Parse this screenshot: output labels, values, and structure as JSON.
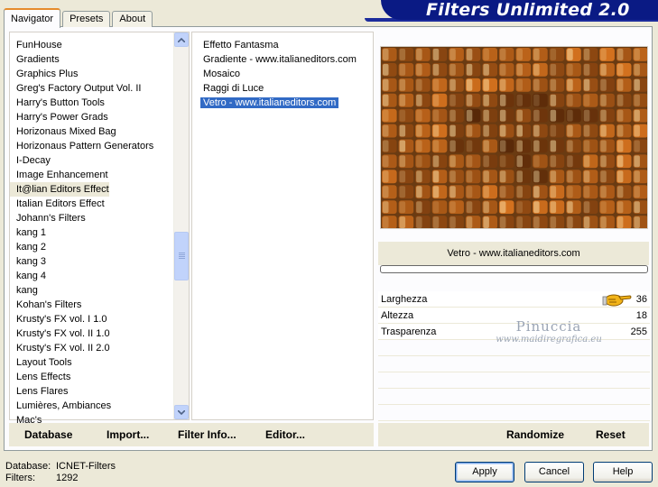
{
  "app": {
    "title": "Filters Unlimited 2.0"
  },
  "tabs": [
    {
      "label": "Navigator",
      "active": true
    },
    {
      "label": "Presets",
      "active": false
    },
    {
      "label": "About",
      "active": false
    }
  ],
  "categories": {
    "items": [
      "FunHouse",
      "Gradients",
      "Graphics Plus",
      "Greg's Factory Output Vol. II",
      "Harry's Button Tools",
      "Harry's Power Grads",
      "Horizonaus Mixed Bag",
      "Horizonaus Pattern Generators",
      "I-Decay",
      "Image Enhancement",
      "It@lian Editors Effect",
      "Italian Editors Effect",
      "Johann's Filters",
      "kang 1",
      "kang 2",
      "kang 3",
      "kang 4",
      "kang",
      "Kohan's Filters",
      "Krusty's FX vol. I 1.0",
      "Krusty's FX vol. II 1.0",
      "Krusty's FX vol. II 2.0",
      "Layout Tools",
      "Lens Effects",
      "Lens Flares",
      "Lumières, Ambiances",
      "Mac's"
    ],
    "selected_index": 10
  },
  "filters": {
    "items": [
      "Effetto Fantasma",
      "Gradiente - www.italianeditors.com",
      "Mosaico",
      "Raggi di Luce",
      "Vetro - www.italianeditors.com"
    ],
    "selected_index": 4
  },
  "filter_panel": {
    "current_filter": "Vetro - www.italianeditors.com",
    "progress": 0,
    "parameters": [
      {
        "name": "Larghezza",
        "value": "36"
      },
      {
        "name": "Altezza",
        "value": "18"
      },
      {
        "name": "Trasparenza",
        "value": "255"
      }
    ],
    "watermark": {
      "line1": "Pinuccia",
      "line2": "www.maidiregrafica.eu"
    }
  },
  "left_bar": {
    "database": {
      "label": "Database",
      "underline": "D"
    },
    "import": {
      "label": "Import...",
      "underline": "I"
    },
    "filter_info": {
      "label": "Filter Info...",
      "underline": "I"
    },
    "editor": {
      "label": "Editor...",
      "underline": "E"
    }
  },
  "right_bar": {
    "randomize": "Randomize",
    "reset": "Reset"
  },
  "status": {
    "database_label": "Database:",
    "database_value": "ICNET-Filters",
    "filters_label": "Filters:",
    "filters_value": "1292"
  },
  "buttons": {
    "apply": "Apply",
    "cancel": "Cancel",
    "help": "Help"
  },
  "colors": {
    "banner": "#0a1a84",
    "selection": "#316ac5",
    "tab_accent": "#e68b2c"
  },
  "icons": {
    "scroll_up": "chevron-up-icon",
    "scroll_down": "chevron-down-icon",
    "pointer": "pointing-hand-icon"
  }
}
